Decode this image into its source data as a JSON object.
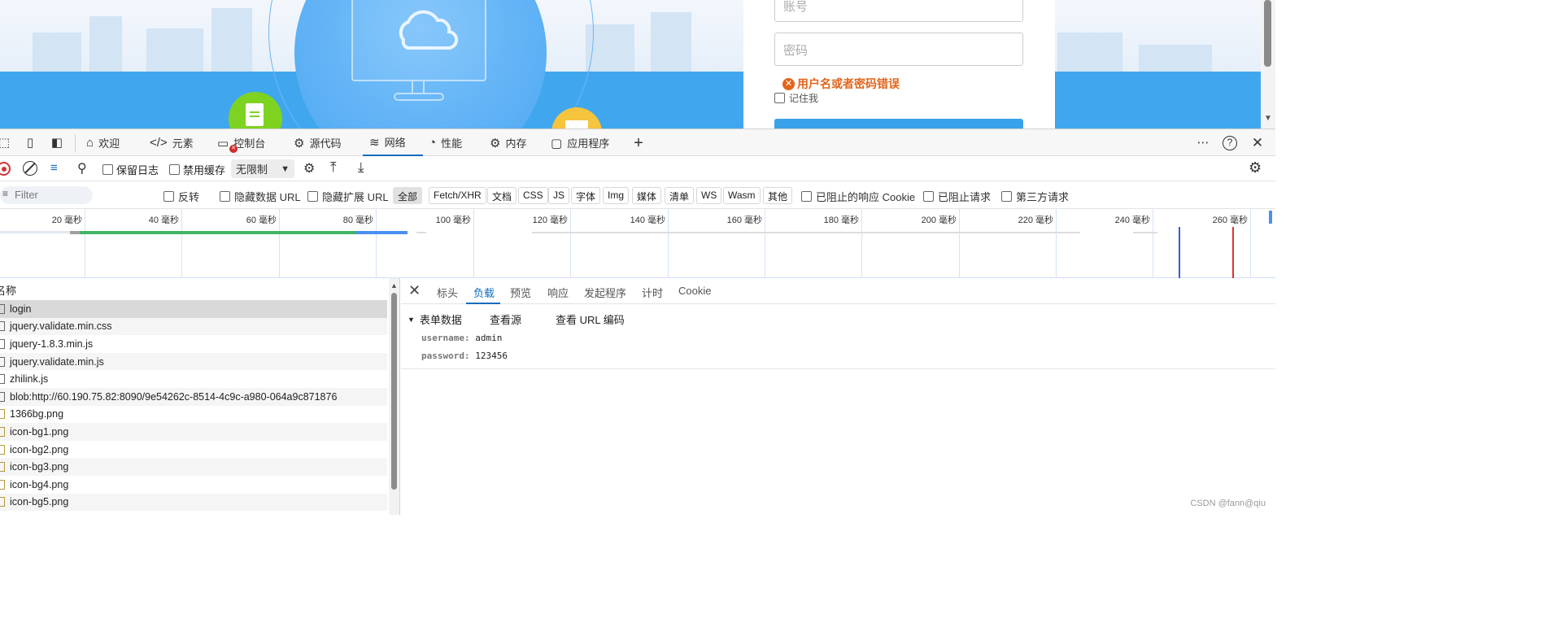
{
  "webpage": {
    "username_placeholder": "账号",
    "password_placeholder": "密码",
    "error_icon": "✕",
    "error_message": "用户名或者密码错误",
    "remember_me": "记住我"
  },
  "devtools_tabs": [
    {
      "label": "欢迎",
      "icon": "home-icon"
    },
    {
      "label": "元素",
      "icon": "code-icon"
    },
    {
      "label": "控制台",
      "icon": "console-icon"
    },
    {
      "label": "源代码",
      "icon": "bug-icon"
    },
    {
      "label": "网络",
      "icon": "wifi-icon",
      "active": true
    },
    {
      "label": "性能",
      "icon": "gauge-icon"
    },
    {
      "label": "内存",
      "icon": "chip-icon"
    },
    {
      "label": "应用程序",
      "icon": "app-icon"
    }
  ],
  "network_toolbar": {
    "preserve_log": "保留日志",
    "disable_cache": "禁用缓存",
    "throttling": "无限制"
  },
  "filter_bar": {
    "placeholder": "Filter",
    "invert": "反转",
    "hide_data_urls": "隐藏数据 URL",
    "hide_extension_urls": "隐藏扩展 URL",
    "types": [
      "全部",
      "Fetch/XHR",
      "文档",
      "CSS",
      "JS",
      "字体",
      "Img",
      "媒体",
      "清单",
      "WS",
      "Wasm",
      "其他"
    ],
    "blocked_cookies": "已阻止的响应 Cookie",
    "blocked_requests": "已阻止请求",
    "third_party": "第三方请求"
  },
  "timeline": {
    "ticks": [
      "20 毫秒",
      "40 毫秒",
      "60 毫秒",
      "80 毫秒",
      "100 毫秒",
      "120 毫秒",
      "140 毫秒",
      "160 毫秒",
      "180 毫秒",
      "200 毫秒",
      "220 毫秒",
      "240 毫秒",
      "260 毫秒"
    ]
  },
  "request_list": {
    "column_name": "名称",
    "rows": [
      {
        "name": "login",
        "type": "doc"
      },
      {
        "name": "jquery.validate.min.css",
        "type": "css"
      },
      {
        "name": "jquery-1.8.3.min.js",
        "type": "js"
      },
      {
        "name": "jquery.validate.min.js",
        "type": "js"
      },
      {
        "name": "zhilink.js",
        "type": "js"
      },
      {
        "name": "blob:http://60.190.75.82:8090/9e54262c-8514-4c9c-a980-064a9c871876",
        "type": "blob"
      },
      {
        "name": "1366bg.png",
        "type": "img"
      },
      {
        "name": "icon-bg1.png",
        "type": "img"
      },
      {
        "name": "icon-bg2.png",
        "type": "img"
      },
      {
        "name": "icon-bg3.png",
        "type": "img"
      },
      {
        "name": "icon-bg4.png",
        "type": "img"
      },
      {
        "name": "icon-bg5.png",
        "type": "img"
      }
    ]
  },
  "detail": {
    "tabs": [
      "标头",
      "负载",
      "预览",
      "响应",
      "发起程序",
      "计时",
      "Cookie"
    ],
    "active_tab": "负载",
    "form_data_title": "表单数据",
    "view_source": "查看源",
    "view_url_encoded": "查看 URL 编码",
    "fields": [
      {
        "key": "username:",
        "value": "admin"
      },
      {
        "key": "password:",
        "value": "123456"
      }
    ]
  },
  "watermark": "CSDN @fann@qiu",
  "colors": {
    "accent": "#0f6cbd",
    "error": "#e2651c",
    "page_blue": "#40a7ee"
  }
}
